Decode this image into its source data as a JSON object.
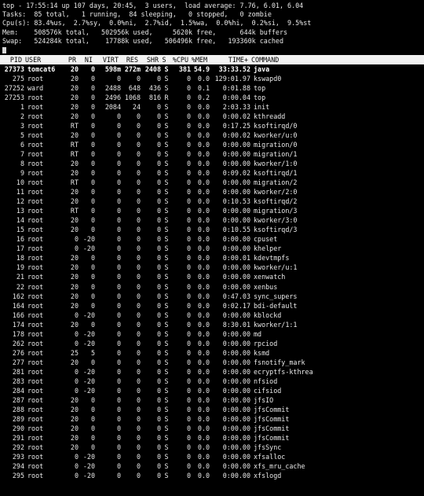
{
  "summary": {
    "line1": "top - 17:55:14 up 107 days, 20:45,  3 users,  load average: 7.76, 6.01, 6.04",
    "line2": "Tasks:  85 total,   1 running,  84 sleeping,   0 stopped,   0 zombie",
    "line3": "Cpu(s): 83.4%us,  2.7%sy,  0.0%ni,  2.7%id,  1.5%wa,  0.0%hi,  0.2%si,  9.5%st",
    "line4": "Mem:    508576k total,   502956k used,     5620k free,      644k buffers",
    "line5": "Swap:   524284k total,    17788k used,   506496k free,   193360k cached"
  },
  "columns": [
    "PID",
    "USER",
    "PR",
    "NI",
    "VIRT",
    "RES",
    "SHR",
    "S",
    "%CPU",
    "%MEM",
    "TIME+",
    "COMMAND"
  ],
  "processes": [
    {
      "pid": "27373",
      "user": "tomcat6",
      "pr": "20",
      "ni": "0",
      "virt": "598m",
      "res": "272m",
      "shr": "2408",
      "s": "S",
      "cpu": "381",
      "mem": "54.9",
      "time": "33:33.52",
      "cmd": "java",
      "bold": true
    },
    {
      "pid": "275",
      "user": "root",
      "pr": "20",
      "ni": "0",
      "virt": "0",
      "res": "0",
      "shr": "0",
      "s": "S",
      "cpu": "0",
      "mem": "0.0",
      "time": "129:01.97",
      "cmd": "kswapd0",
      "bold": false
    },
    {
      "pid": "27252",
      "user": "ward",
      "pr": "20",
      "ni": "0",
      "virt": "2488",
      "res": "648",
      "shr": "436",
      "s": "S",
      "cpu": "0",
      "mem": "0.1",
      "time": "0:01.88",
      "cmd": "top",
      "bold": false
    },
    {
      "pid": "27253",
      "user": "root",
      "pr": "20",
      "ni": "0",
      "virt": "2496",
      "res": "1068",
      "shr": "816",
      "s": "R",
      "cpu": "0",
      "mem": "0.2",
      "time": "0:00.04",
      "cmd": "top",
      "bold": false
    },
    {
      "pid": "1",
      "user": "root",
      "pr": "20",
      "ni": "0",
      "virt": "2084",
      "res": "24",
      "shr": "0",
      "s": "S",
      "cpu": "0",
      "mem": "0.0",
      "time": "2:03.33",
      "cmd": "init",
      "bold": false
    },
    {
      "pid": "2",
      "user": "root",
      "pr": "20",
      "ni": "0",
      "virt": "0",
      "res": "0",
      "shr": "0",
      "s": "S",
      "cpu": "0",
      "mem": "0.0",
      "time": "0:00.02",
      "cmd": "kthreadd",
      "bold": false
    },
    {
      "pid": "3",
      "user": "root",
      "pr": "RT",
      "ni": "0",
      "virt": "0",
      "res": "0",
      "shr": "0",
      "s": "S",
      "cpu": "0",
      "mem": "0.0",
      "time": "0:17.25",
      "cmd": "ksoftirqd/0",
      "bold": false
    },
    {
      "pid": "5",
      "user": "root",
      "pr": "20",
      "ni": "0",
      "virt": "0",
      "res": "0",
      "shr": "0",
      "s": "S",
      "cpu": "0",
      "mem": "0.0",
      "time": "0:00.02",
      "cmd": "kworker/u:0",
      "bold": false
    },
    {
      "pid": "6",
      "user": "root",
      "pr": "RT",
      "ni": "0",
      "virt": "0",
      "res": "0",
      "shr": "0",
      "s": "S",
      "cpu": "0",
      "mem": "0.0",
      "time": "0:00.00",
      "cmd": "migration/0",
      "bold": false
    },
    {
      "pid": "7",
      "user": "root",
      "pr": "RT",
      "ni": "0",
      "virt": "0",
      "res": "0",
      "shr": "0",
      "s": "S",
      "cpu": "0",
      "mem": "0.0",
      "time": "0:00.00",
      "cmd": "migration/1",
      "bold": false
    },
    {
      "pid": "8",
      "user": "root",
      "pr": "20",
      "ni": "0",
      "virt": "0",
      "res": "0",
      "shr": "0",
      "s": "S",
      "cpu": "0",
      "mem": "0.0",
      "time": "0:00.00",
      "cmd": "kworker/1:0",
      "bold": false
    },
    {
      "pid": "9",
      "user": "root",
      "pr": "20",
      "ni": "0",
      "virt": "0",
      "res": "0",
      "shr": "0",
      "s": "S",
      "cpu": "0",
      "mem": "0.0",
      "time": "0:09.02",
      "cmd": "ksoftirqd/1",
      "bold": false
    },
    {
      "pid": "10",
      "user": "root",
      "pr": "RT",
      "ni": "0",
      "virt": "0",
      "res": "0",
      "shr": "0",
      "s": "S",
      "cpu": "0",
      "mem": "0.0",
      "time": "0:00.00",
      "cmd": "migration/2",
      "bold": false
    },
    {
      "pid": "11",
      "user": "root",
      "pr": "20",
      "ni": "0",
      "virt": "0",
      "res": "0",
      "shr": "0",
      "s": "S",
      "cpu": "0",
      "mem": "0.0",
      "time": "0:00.00",
      "cmd": "kworker/2:0",
      "bold": false
    },
    {
      "pid": "12",
      "user": "root",
      "pr": "20",
      "ni": "0",
      "virt": "0",
      "res": "0",
      "shr": "0",
      "s": "S",
      "cpu": "0",
      "mem": "0.0",
      "time": "0:10.53",
      "cmd": "ksoftirqd/2",
      "bold": false
    },
    {
      "pid": "13",
      "user": "root",
      "pr": "RT",
      "ni": "0",
      "virt": "0",
      "res": "0",
      "shr": "0",
      "s": "S",
      "cpu": "0",
      "mem": "0.0",
      "time": "0:00.00",
      "cmd": "migration/3",
      "bold": false
    },
    {
      "pid": "14",
      "user": "root",
      "pr": "20",
      "ni": "0",
      "virt": "0",
      "res": "0",
      "shr": "0",
      "s": "S",
      "cpu": "0",
      "mem": "0.0",
      "time": "0:00.00",
      "cmd": "kworker/3:0",
      "bold": false
    },
    {
      "pid": "15",
      "user": "root",
      "pr": "20",
      "ni": "0",
      "virt": "0",
      "res": "0",
      "shr": "0",
      "s": "S",
      "cpu": "0",
      "mem": "0.0",
      "time": "0:10.55",
      "cmd": "ksoftirqd/3",
      "bold": false
    },
    {
      "pid": "16",
      "user": "root",
      "pr": "0",
      "ni": "-20",
      "virt": "0",
      "res": "0",
      "shr": "0",
      "s": "S",
      "cpu": "0",
      "mem": "0.0",
      "time": "0:00.00",
      "cmd": "cpuset",
      "bold": false
    },
    {
      "pid": "17",
      "user": "root",
      "pr": "0",
      "ni": "-20",
      "virt": "0",
      "res": "0",
      "shr": "0",
      "s": "S",
      "cpu": "0",
      "mem": "0.0",
      "time": "0:00.00",
      "cmd": "khelper",
      "bold": false
    },
    {
      "pid": "18",
      "user": "root",
      "pr": "20",
      "ni": "0",
      "virt": "0",
      "res": "0",
      "shr": "0",
      "s": "S",
      "cpu": "0",
      "mem": "0.0",
      "time": "0:00.01",
      "cmd": "kdevtmpfs",
      "bold": false
    },
    {
      "pid": "19",
      "user": "root",
      "pr": "20",
      "ni": "0",
      "virt": "0",
      "res": "0",
      "shr": "0",
      "s": "S",
      "cpu": "0",
      "mem": "0.0",
      "time": "0:00.00",
      "cmd": "kworker/u:1",
      "bold": false
    },
    {
      "pid": "21",
      "user": "root",
      "pr": "20",
      "ni": "0",
      "virt": "0",
      "res": "0",
      "shr": "0",
      "s": "S",
      "cpu": "0",
      "mem": "0.0",
      "time": "0:00.00",
      "cmd": "xenwatch",
      "bold": false
    },
    {
      "pid": "22",
      "user": "root",
      "pr": "20",
      "ni": "0",
      "virt": "0",
      "res": "0",
      "shr": "0",
      "s": "S",
      "cpu": "0",
      "mem": "0.0",
      "time": "0:00.00",
      "cmd": "xenbus",
      "bold": false
    },
    {
      "pid": "162",
      "user": "root",
      "pr": "20",
      "ni": "0",
      "virt": "0",
      "res": "0",
      "shr": "0",
      "s": "S",
      "cpu": "0",
      "mem": "0.0",
      "time": "0:47.03",
      "cmd": "sync_supers",
      "bold": false
    },
    {
      "pid": "164",
      "user": "root",
      "pr": "20",
      "ni": "0",
      "virt": "0",
      "res": "0",
      "shr": "0",
      "s": "S",
      "cpu": "0",
      "mem": "0.0",
      "time": "0:02.17",
      "cmd": "bdi-default",
      "bold": false
    },
    {
      "pid": "166",
      "user": "root",
      "pr": "0",
      "ni": "-20",
      "virt": "0",
      "res": "0",
      "shr": "0",
      "s": "S",
      "cpu": "0",
      "mem": "0.0",
      "time": "0:00.00",
      "cmd": "kblockd",
      "bold": false
    },
    {
      "pid": "174",
      "user": "root",
      "pr": "20",
      "ni": "0",
      "virt": "0",
      "res": "0",
      "shr": "0",
      "s": "S",
      "cpu": "0",
      "mem": "0.0",
      "time": "8:30.01",
      "cmd": "kworker/1:1",
      "bold": false
    },
    {
      "pid": "178",
      "user": "root",
      "pr": "0",
      "ni": "-20",
      "virt": "0",
      "res": "0",
      "shr": "0",
      "s": "S",
      "cpu": "0",
      "mem": "0.0",
      "time": "0:00.00",
      "cmd": "md",
      "bold": false
    },
    {
      "pid": "262",
      "user": "root",
      "pr": "0",
      "ni": "-20",
      "virt": "0",
      "res": "0",
      "shr": "0",
      "s": "S",
      "cpu": "0",
      "mem": "0.0",
      "time": "0:00.00",
      "cmd": "rpciod",
      "bold": false
    },
    {
      "pid": "276",
      "user": "root",
      "pr": "25",
      "ni": "5",
      "virt": "0",
      "res": "0",
      "shr": "0",
      "s": "S",
      "cpu": "0",
      "mem": "0.0",
      "time": "0:00.00",
      "cmd": "ksmd",
      "bold": false
    },
    {
      "pid": "277",
      "user": "root",
      "pr": "20",
      "ni": "0",
      "virt": "0",
      "res": "0",
      "shr": "0",
      "s": "S",
      "cpu": "0",
      "mem": "0.0",
      "time": "0:00.00",
      "cmd": "fsnotify_mark",
      "bold": false
    },
    {
      "pid": "281",
      "user": "root",
      "pr": "0",
      "ni": "-20",
      "virt": "0",
      "res": "0",
      "shr": "0",
      "s": "S",
      "cpu": "0",
      "mem": "0.0",
      "time": "0:00.00",
      "cmd": "ecryptfs-kthrea",
      "bold": false
    },
    {
      "pid": "283",
      "user": "root",
      "pr": "0",
      "ni": "-20",
      "virt": "0",
      "res": "0",
      "shr": "0",
      "s": "S",
      "cpu": "0",
      "mem": "0.0",
      "time": "0:00.00",
      "cmd": "nfsiod",
      "bold": false
    },
    {
      "pid": "284",
      "user": "root",
      "pr": "0",
      "ni": "-20",
      "virt": "0",
      "res": "0",
      "shr": "0",
      "s": "S",
      "cpu": "0",
      "mem": "0.0",
      "time": "0:00.00",
      "cmd": "cifsiod",
      "bold": false
    },
    {
      "pid": "287",
      "user": "root",
      "pr": "20",
      "ni": "0",
      "virt": "0",
      "res": "0",
      "shr": "0",
      "s": "S",
      "cpu": "0",
      "mem": "0.0",
      "time": "0:00.00",
      "cmd": "jfsIO",
      "bold": false
    },
    {
      "pid": "288",
      "user": "root",
      "pr": "20",
      "ni": "0",
      "virt": "0",
      "res": "0",
      "shr": "0",
      "s": "S",
      "cpu": "0",
      "mem": "0.0",
      "time": "0:00.00",
      "cmd": "jfsCommit",
      "bold": false
    },
    {
      "pid": "289",
      "user": "root",
      "pr": "20",
      "ni": "0",
      "virt": "0",
      "res": "0",
      "shr": "0",
      "s": "S",
      "cpu": "0",
      "mem": "0.0",
      "time": "0:00.00",
      "cmd": "jfsCommit",
      "bold": false
    },
    {
      "pid": "290",
      "user": "root",
      "pr": "20",
      "ni": "0",
      "virt": "0",
      "res": "0",
      "shr": "0",
      "s": "S",
      "cpu": "0",
      "mem": "0.0",
      "time": "0:00.00",
      "cmd": "jfsCommit",
      "bold": false
    },
    {
      "pid": "291",
      "user": "root",
      "pr": "20",
      "ni": "0",
      "virt": "0",
      "res": "0",
      "shr": "0",
      "s": "S",
      "cpu": "0",
      "mem": "0.0",
      "time": "0:00.00",
      "cmd": "jfsCommit",
      "bold": false
    },
    {
      "pid": "292",
      "user": "root",
      "pr": "20",
      "ni": "0",
      "virt": "0",
      "res": "0",
      "shr": "0",
      "s": "S",
      "cpu": "0",
      "mem": "0.0",
      "time": "0:00.00",
      "cmd": "jfsSync",
      "bold": false
    },
    {
      "pid": "293",
      "user": "root",
      "pr": "0",
      "ni": "-20",
      "virt": "0",
      "res": "0",
      "shr": "0",
      "s": "S",
      "cpu": "0",
      "mem": "0.0",
      "time": "0:00.00",
      "cmd": "xfsalloc",
      "bold": false
    },
    {
      "pid": "294",
      "user": "root",
      "pr": "0",
      "ni": "-20",
      "virt": "0",
      "res": "0",
      "shr": "0",
      "s": "S",
      "cpu": "0",
      "mem": "0.0",
      "time": "0:00.00",
      "cmd": "xfs_mru_cache",
      "bold": false
    },
    {
      "pid": "295",
      "user": "root",
      "pr": "0",
      "ni": "-20",
      "virt": "0",
      "res": "0",
      "shr": "0",
      "s": "S",
      "cpu": "0",
      "mem": "0.0",
      "time": "0:00.00",
      "cmd": "xfslogd",
      "bold": false
    }
  ]
}
